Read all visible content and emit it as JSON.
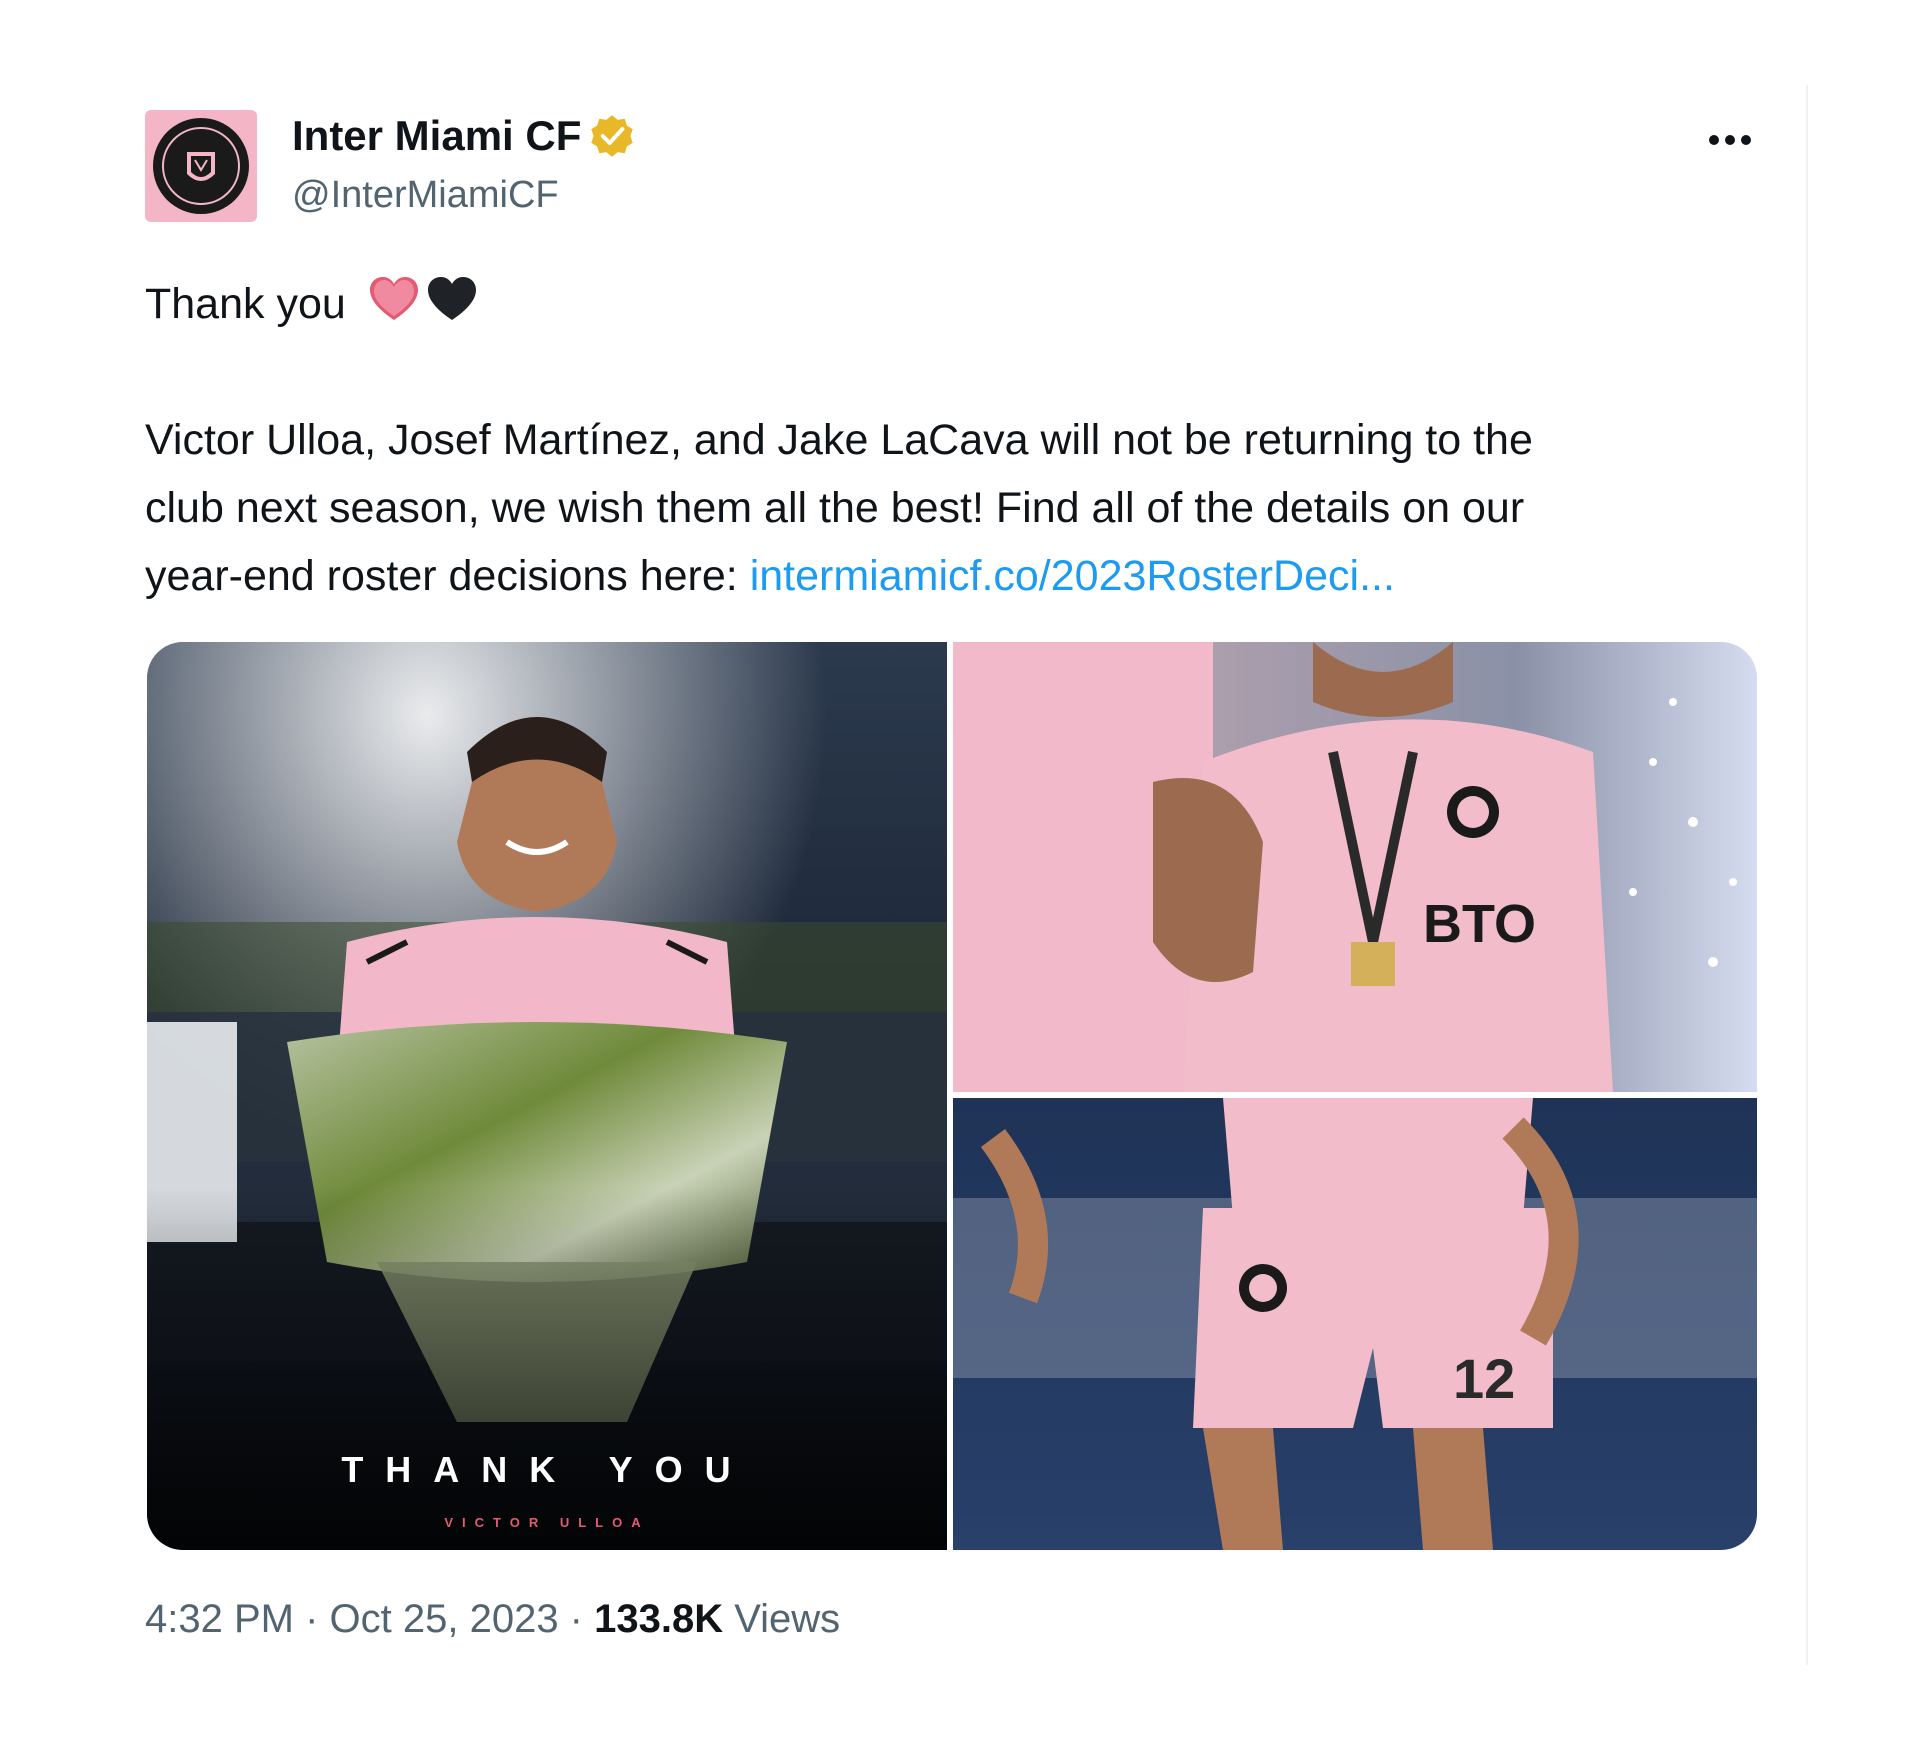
{
  "account": {
    "display_name": "Inter Miami CF",
    "handle": "@InterMiamiCF",
    "verified_badge_icon": "gold-verified-badge-icon",
    "avatar_icon": "inter-miami-crest-icon"
  },
  "tweet": {
    "line1": "Thank you",
    "line1_emojis": [
      "pink-heart-icon",
      "black-heart-icon"
    ],
    "body_line1": "Victor Ulloa, Josef Martínez, and Jake LaCava will not be returning to the",
    "body_line2": "club next season, we wish them all the best! Find all of the details on our",
    "body_line3_prefix": "year-end roster decisions here: ",
    "link_text": "intermiamicf.co/2023RosterDeci..."
  },
  "media": {
    "tile1_caption": "THANK YOU",
    "tile1_subcaption": "VICTOR ULLOA",
    "tile2_jersey_text": "BTO",
    "tile3_number": "12"
  },
  "footer": {
    "time": "4:32 PM",
    "sep1": " · ",
    "date": "Oct 25, 2023",
    "sep2": " · ",
    "views_count": "133.8K",
    "views_label": " Views"
  },
  "more_icon": "more-options-icon",
  "colors": {
    "link": "#1d9bf0",
    "secondary_text": "#536471",
    "brand_pink": "#f4b6c6",
    "verified_gold": "#e8b829"
  }
}
